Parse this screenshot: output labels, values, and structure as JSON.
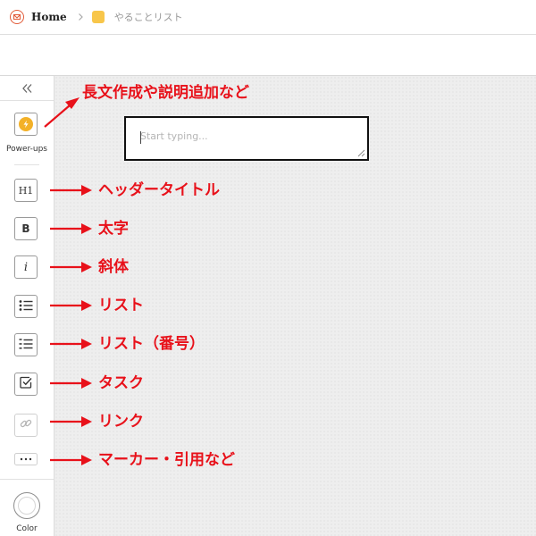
{
  "header": {
    "home_label": "Home",
    "page_title": "やることリスト",
    "logo_icon": "app-logo-icon",
    "brand_color": "#e25c3a",
    "page_icon_color": "#f8c64a"
  },
  "sidebar": {
    "collapse_icon": "double-chevron-left-icon",
    "power_ups_label": "Power-ups",
    "power_icon_color": "#f3b128",
    "tools": [
      {
        "id": "h1",
        "icon": "heading-icon",
        "glyph": "H1"
      },
      {
        "id": "bold",
        "icon": "bold-icon",
        "glyph": "B"
      },
      {
        "id": "italic",
        "icon": "italic-icon",
        "glyph": "i"
      },
      {
        "id": "bullet-list",
        "icon": "bullet-list-icon"
      },
      {
        "id": "numbered-list",
        "icon": "numbered-list-icon"
      },
      {
        "id": "task",
        "icon": "checkbox-icon"
      },
      {
        "id": "link",
        "icon": "link-icon"
      },
      {
        "id": "more",
        "icon": "more-icon"
      }
    ],
    "color_label": "Color"
  },
  "editor": {
    "placeholder": "Start typing...",
    "value": ""
  },
  "annotations": {
    "color": "#e8111a",
    "items": [
      "長文作成や説明追加など",
      "ヘッダータイトル",
      "太字",
      "斜体",
      "リスト",
      "リスト（番号）",
      "タスク",
      "リンク",
      "マーカー・引用など"
    ]
  }
}
